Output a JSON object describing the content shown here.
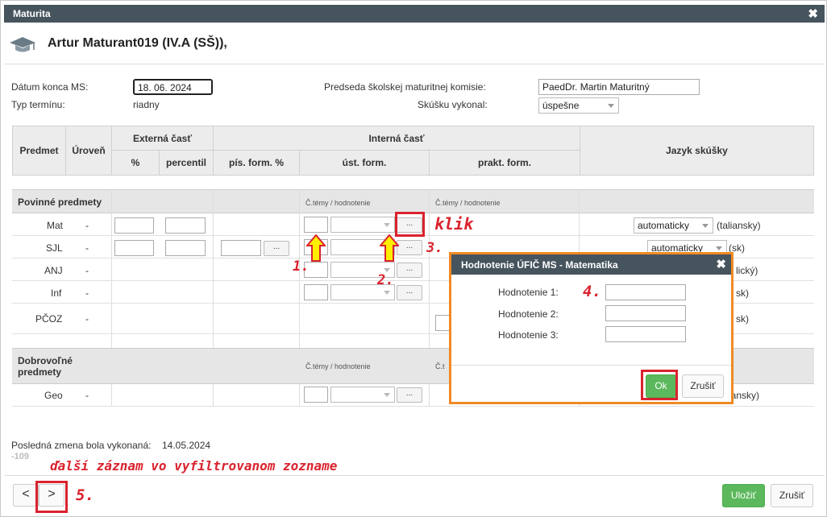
{
  "window": {
    "title": "Maturita",
    "close": "✖"
  },
  "header": {
    "student_name": "Artur Maturant019 (IV.A (SŠ)),",
    "icon": "graduation-cap-icon"
  },
  "form": {
    "end_date_label": "Dátum konca MS:",
    "end_date_value": "18. 06. 2024",
    "term_type_label": "Typ termínu:",
    "term_type_value": "riadny",
    "chairman_label": "Predseda školskej maturitnej komisie:",
    "chairman_value": "PaedDr. Martin Maturitný",
    "passed_label": "Skúšku vykonal:",
    "passed_value": "úspešne"
  },
  "table": {
    "headers": {
      "subject": "Predmet",
      "level": "Úroveň",
      "external": "Externá časť",
      "percent": "%",
      "percentile": "percentil",
      "internal": "Interná časť",
      "written": "pís. form. %",
      "oral": "úst. form.",
      "practical": "prakt. form.",
      "language": "Jazyk skúšky"
    },
    "mandatory_label": "Povinné predmety",
    "voluntary_label": "Dobrovoľné predmety",
    "theme_header": "Č.témy / hodnotenie",
    "theme_header_short": "Č.t",
    "rows": [
      {
        "subject": "Mat",
        "level": "-",
        "language_select": "automaticky",
        "language": "(taliansky)"
      },
      {
        "subject": "SJL",
        "level": "-",
        "language_select": "automaticky",
        "language": "(sk)"
      },
      {
        "subject": "ANJ",
        "level": "-",
        "language": "lický)"
      },
      {
        "subject": "Inf",
        "level": "-",
        "language": "sk)"
      },
      {
        "subject": "PČOZ",
        "level": "-",
        "language": "sk)"
      },
      {
        "subject": "Geo",
        "level": "-",
        "language": "lansky)"
      }
    ],
    "btn_dots": "..."
  },
  "footer": {
    "last_change_label": "Posledná zmena bola vykonaná:",
    "last_change_value": "14.05.2024",
    "code": "-109",
    "prev": "<",
    "next": ">",
    "save": "Uložiť",
    "cancel": "Zrušiť"
  },
  "dialog": {
    "title": "Hodnotenie ÚFIČ MS - Matematika",
    "close": "✖",
    "field1": "Hodnotenie 1:",
    "field2": "Hodnotenie 2:",
    "field3": "Hodnotenie 3:",
    "ok": "Ok",
    "cancel": "Zrušiť"
  },
  "annotations": {
    "step1": "1.",
    "step2": "2.",
    "step3": "3.",
    "step4": "4.",
    "step5": "5.",
    "klik": "klik",
    "next_hint": "ďalší záznam vo vyfiltrovanom zozname"
  },
  "colors": {
    "titlebar": "#46545e",
    "accent_green": "#5cb85c",
    "annotation_red": "#d9232e",
    "dialog_border": "#f08a24",
    "arrow_yellow": "#ffee00"
  }
}
